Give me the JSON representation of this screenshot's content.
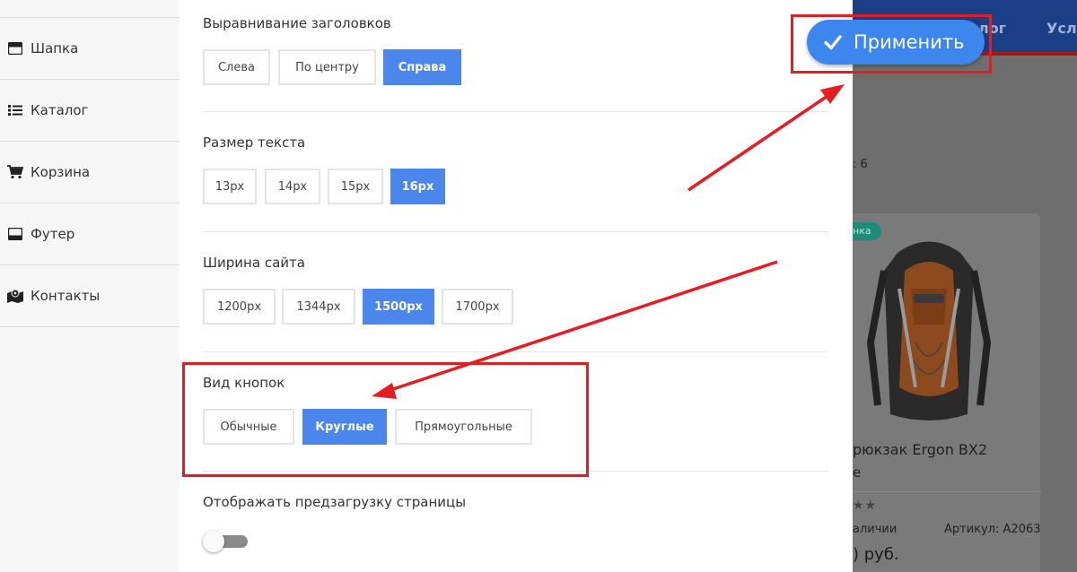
{
  "sidebar": {
    "items": [
      {
        "label": "Шапка",
        "icon": "header-icon"
      },
      {
        "label": "Каталог",
        "icon": "list-icon"
      },
      {
        "label": "Корзина",
        "icon": "cart-icon"
      },
      {
        "label": "Футер",
        "icon": "footer-icon"
      },
      {
        "label": "Контакты",
        "icon": "map-marker-icon"
      }
    ]
  },
  "settings": {
    "heading_align": {
      "label": "Выравнивание заголовков",
      "options": [
        "Слева",
        "По центру",
        "Справа"
      ],
      "selected": "Справа"
    },
    "text_size": {
      "label": "Размер текста",
      "options": [
        "13px",
        "14px",
        "15px",
        "16px"
      ],
      "selected": "16px"
    },
    "site_width": {
      "label": "Ширина сайта",
      "options": [
        "1200px",
        "1344px",
        "1500px",
        "1700px"
      ],
      "selected": "1500px"
    },
    "button_style": {
      "label": "Вид кнопок",
      "options": [
        "Обычные",
        "Круглые",
        "Прямоугольные"
      ],
      "selected": "Круглые"
    },
    "preloader": {
      "label": "Отображать предзагрузку страницы",
      "enabled": false
    }
  },
  "apply_button": {
    "label": "Применить",
    "icon": "check-icon"
  },
  "background_site": {
    "nav_items": [
      "лог",
      "Усл"
    ],
    "count_text": ": 6",
    "badge": "нка",
    "product_title": "рюкзак Ergon BX2",
    "product_sub": "е",
    "stars": "★★",
    "availability": "аличии",
    "sku": "Артикул: A2063",
    "price": ") руб."
  },
  "colors": {
    "accent": "#4a86ec",
    "annotation": "#e51d23",
    "nav_bg": "#1a3f86"
  }
}
